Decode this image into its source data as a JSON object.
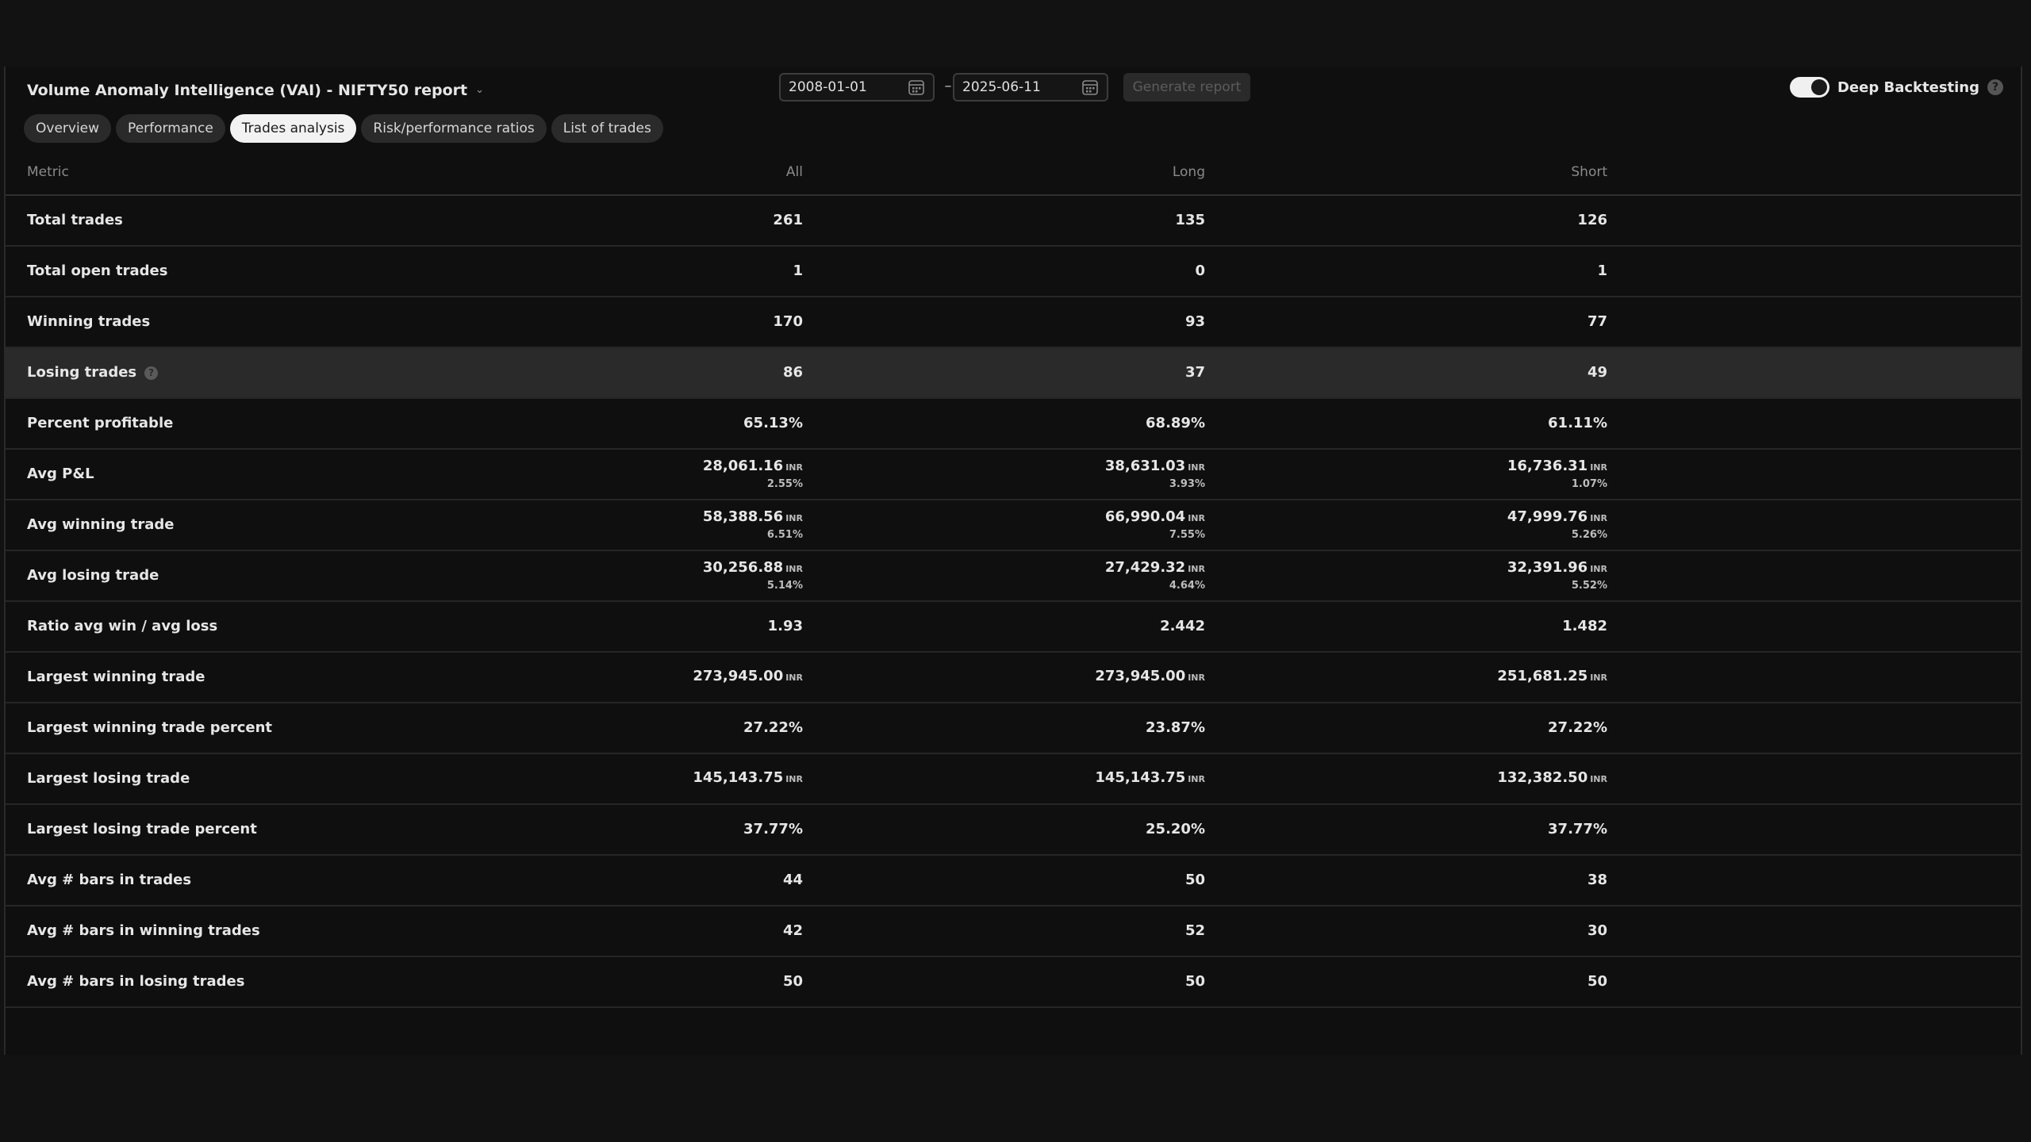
{
  "header": {
    "title": "Volume Anomaly Intelligence (VAI) - NIFTY50 report",
    "date_from": "2008-01-01",
    "date_separator": "–",
    "date_to": "2025-06-11",
    "generate_label": "Generate report",
    "deep_backtesting_label": "Deep Backtesting",
    "deep_backtesting_on": true
  },
  "tabs": [
    {
      "label": "Overview",
      "active": false
    },
    {
      "label": "Performance",
      "active": false
    },
    {
      "label": "Trades analysis",
      "active": true
    },
    {
      "label": "Risk/performance ratios",
      "active": false
    },
    {
      "label": "List of trades",
      "active": false
    }
  ],
  "table": {
    "columns": [
      "Metric",
      "All",
      "Long",
      "Short"
    ],
    "unit": "INR",
    "rows": [
      {
        "metric": "Total trades",
        "all": {
          "v": "261"
        },
        "long": {
          "v": "135"
        },
        "short": {
          "v": "126"
        }
      },
      {
        "metric": "Total open trades",
        "all": {
          "v": "1"
        },
        "long": {
          "v": "0"
        },
        "short": {
          "v": "1"
        }
      },
      {
        "metric": "Winning trades",
        "all": {
          "v": "170"
        },
        "long": {
          "v": "93"
        },
        "short": {
          "v": "77"
        }
      },
      {
        "metric": "Losing trades",
        "info": true,
        "highlight": true,
        "all": {
          "v": "86"
        },
        "long": {
          "v": "37"
        },
        "short": {
          "v": "49"
        }
      },
      {
        "metric": "Percent profitable",
        "all": {
          "v": "65.13%"
        },
        "long": {
          "v": "68.89%"
        },
        "short": {
          "v": "61.11%"
        }
      },
      {
        "metric": "Avg P&L",
        "all": {
          "v": "28,061.16",
          "u": "INR",
          "s": "2.55%"
        },
        "long": {
          "v": "38,631.03",
          "u": "INR",
          "s": "3.93%"
        },
        "short": {
          "v": "16,736.31",
          "u": "INR",
          "s": "1.07%"
        }
      },
      {
        "metric": "Avg winning trade",
        "all": {
          "v": "58,388.56",
          "u": "INR",
          "s": "6.51%"
        },
        "long": {
          "v": "66,990.04",
          "u": "INR",
          "s": "7.55%"
        },
        "short": {
          "v": "47,999.76",
          "u": "INR",
          "s": "5.26%"
        }
      },
      {
        "metric": "Avg losing trade",
        "all": {
          "v": "30,256.88",
          "u": "INR",
          "s": "5.14%"
        },
        "long": {
          "v": "27,429.32",
          "u": "INR",
          "s": "4.64%"
        },
        "short": {
          "v": "32,391.96",
          "u": "INR",
          "s": "5.52%"
        }
      },
      {
        "metric": "Ratio avg win / avg loss",
        "all": {
          "v": "1.93"
        },
        "long": {
          "v": "2.442"
        },
        "short": {
          "v": "1.482"
        }
      },
      {
        "metric": "Largest winning trade",
        "all": {
          "v": "273,945.00",
          "u": "INR"
        },
        "long": {
          "v": "273,945.00",
          "u": "INR"
        },
        "short": {
          "v": "251,681.25",
          "u": "INR"
        }
      },
      {
        "metric": "Largest winning trade percent",
        "all": {
          "v": "27.22%"
        },
        "long": {
          "v": "23.87%"
        },
        "short": {
          "v": "27.22%"
        }
      },
      {
        "metric": "Largest losing trade",
        "all": {
          "v": "145,143.75",
          "u": "INR"
        },
        "long": {
          "v": "145,143.75",
          "u": "INR"
        },
        "short": {
          "v": "132,382.50",
          "u": "INR"
        }
      },
      {
        "metric": "Largest losing trade percent",
        "all": {
          "v": "37.77%"
        },
        "long": {
          "v": "25.20%"
        },
        "short": {
          "v": "37.77%"
        }
      },
      {
        "metric": "Avg # bars in trades",
        "all": {
          "v": "44"
        },
        "long": {
          "v": "50"
        },
        "short": {
          "v": "38"
        }
      },
      {
        "metric": "Avg # bars in winning trades",
        "all": {
          "v": "42"
        },
        "long": {
          "v": "52"
        },
        "short": {
          "v": "30"
        }
      },
      {
        "metric": "Avg # bars in losing trades",
        "all": {
          "v": "50"
        },
        "long": {
          "v": "50"
        },
        "short": {
          "v": "50"
        }
      }
    ]
  }
}
